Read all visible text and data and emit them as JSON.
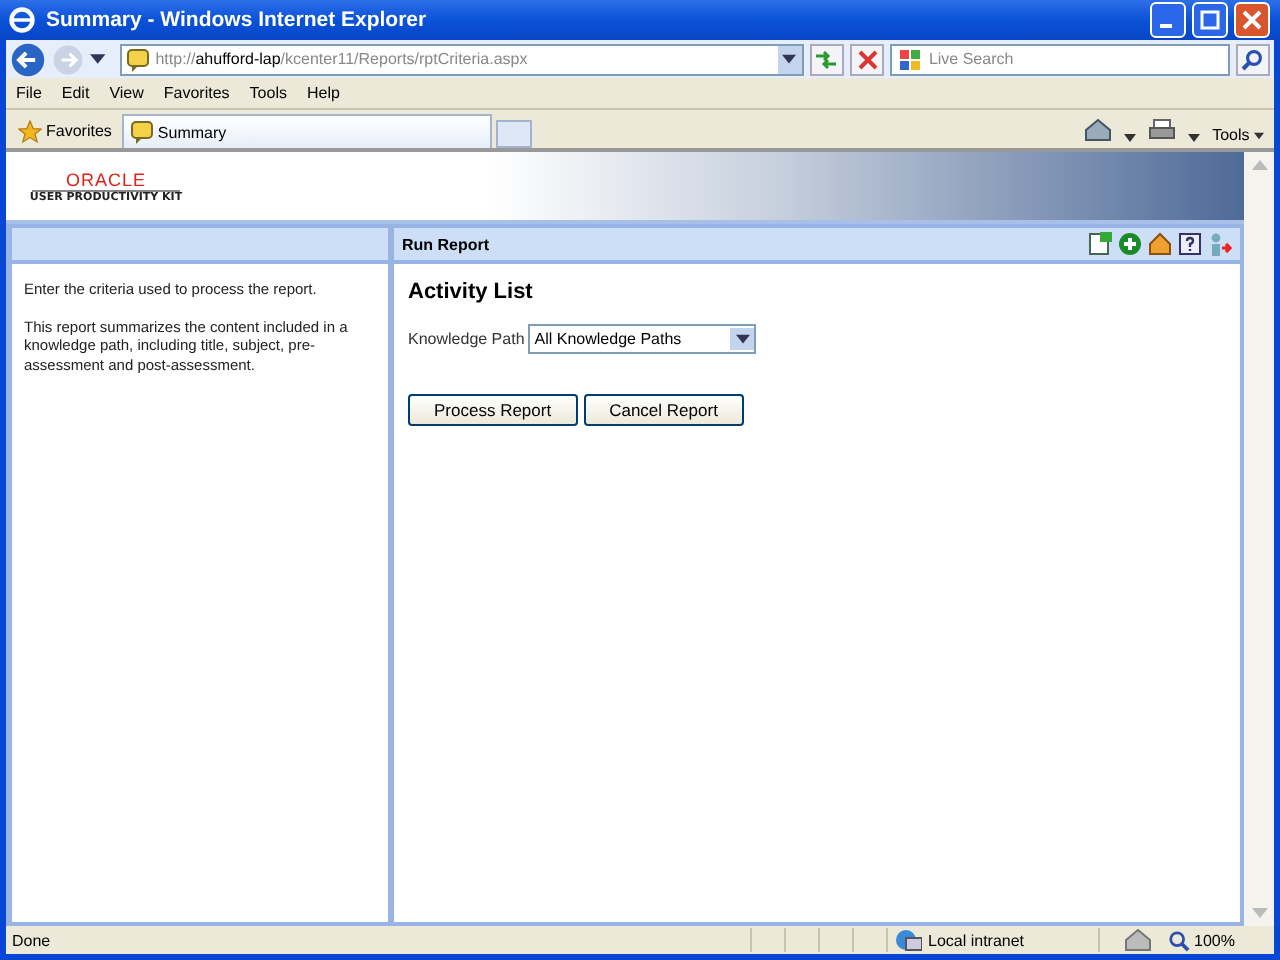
{
  "window": {
    "title": "Summary - Windows Internet Explorer"
  },
  "address_bar": {
    "scheme": "http://",
    "host": "ahufford-lap",
    "path": "/kcenter11/Reports/rptCriteria.aspx"
  },
  "search": {
    "placeholder": "Live Search"
  },
  "menu": [
    "File",
    "Edit",
    "View",
    "Favorites",
    "Tools",
    "Help"
  ],
  "favorites_label": "Favorites",
  "tabs": [
    {
      "label": "Summary",
      "selected": true
    }
  ],
  "tools_label": "Tools",
  "logo": {
    "brand": "ORACLE",
    "product": "USER PRODUCTIVITY KIT"
  },
  "left_panel": {
    "paragraphs": [
      "Enter the criteria used to process the report.",
      "This report summarizes the content included in a knowledge path, including title, subject, pre-assessment and post-assessment."
    ]
  },
  "main_panel": {
    "header": "Run Report",
    "title": "Activity List",
    "field_label": "Knowledge Path",
    "field_value": "All Knowledge Paths",
    "buttons": [
      "Process Report",
      "Cancel Report"
    ]
  },
  "status_bar": {
    "text": "Done",
    "zone": "Local intranet",
    "zoom": "100%"
  }
}
